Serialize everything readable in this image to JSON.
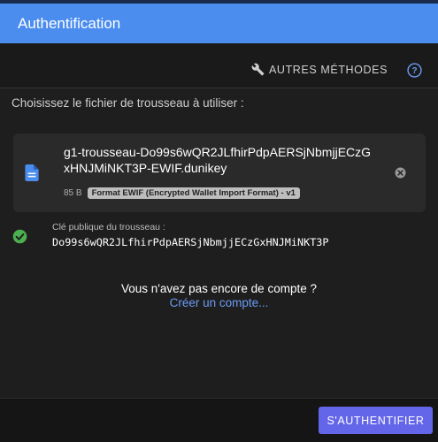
{
  "dialog": {
    "title": "Authentification"
  },
  "toolbar": {
    "other_methods_label": "AUTRES MÉTHODES",
    "other_methods_icon": "wrench-icon",
    "help_icon": "help-circle-icon"
  },
  "instructions": "Choisissez le fichier de trousseau à utiliser :",
  "file": {
    "name": "g1-trousseau-Do99s6wQR2JLfhirPdpAERSjNbmjjECzGxHNJMiNKT3P-EWIF.dunikey",
    "size": "85 B",
    "format": "Format EWIF (Encrypted Wallet Import Format) - v1",
    "icon": "file-document-icon",
    "clear_icon": "close-circle-icon"
  },
  "public_key": {
    "label": "Clé publique du trousseau :",
    "value": "Do99s6wQR2JLfhirPdpAERSjNbmjjECzGxHNJMiNKT3P",
    "status_icon": "check-circle-icon"
  },
  "account": {
    "question": "Vous n'avez pas encore de compte ?",
    "create_link": "Créer un compte..."
  },
  "footer": {
    "submit_label": "S'AUTHENTIFIER"
  },
  "colors": {
    "header": "#4b8def",
    "primary_button": "#6466e9",
    "link": "#6b9cf5",
    "success": "#4caf50",
    "file_icon": "#4b8def",
    "background": "#1e1e1e"
  }
}
